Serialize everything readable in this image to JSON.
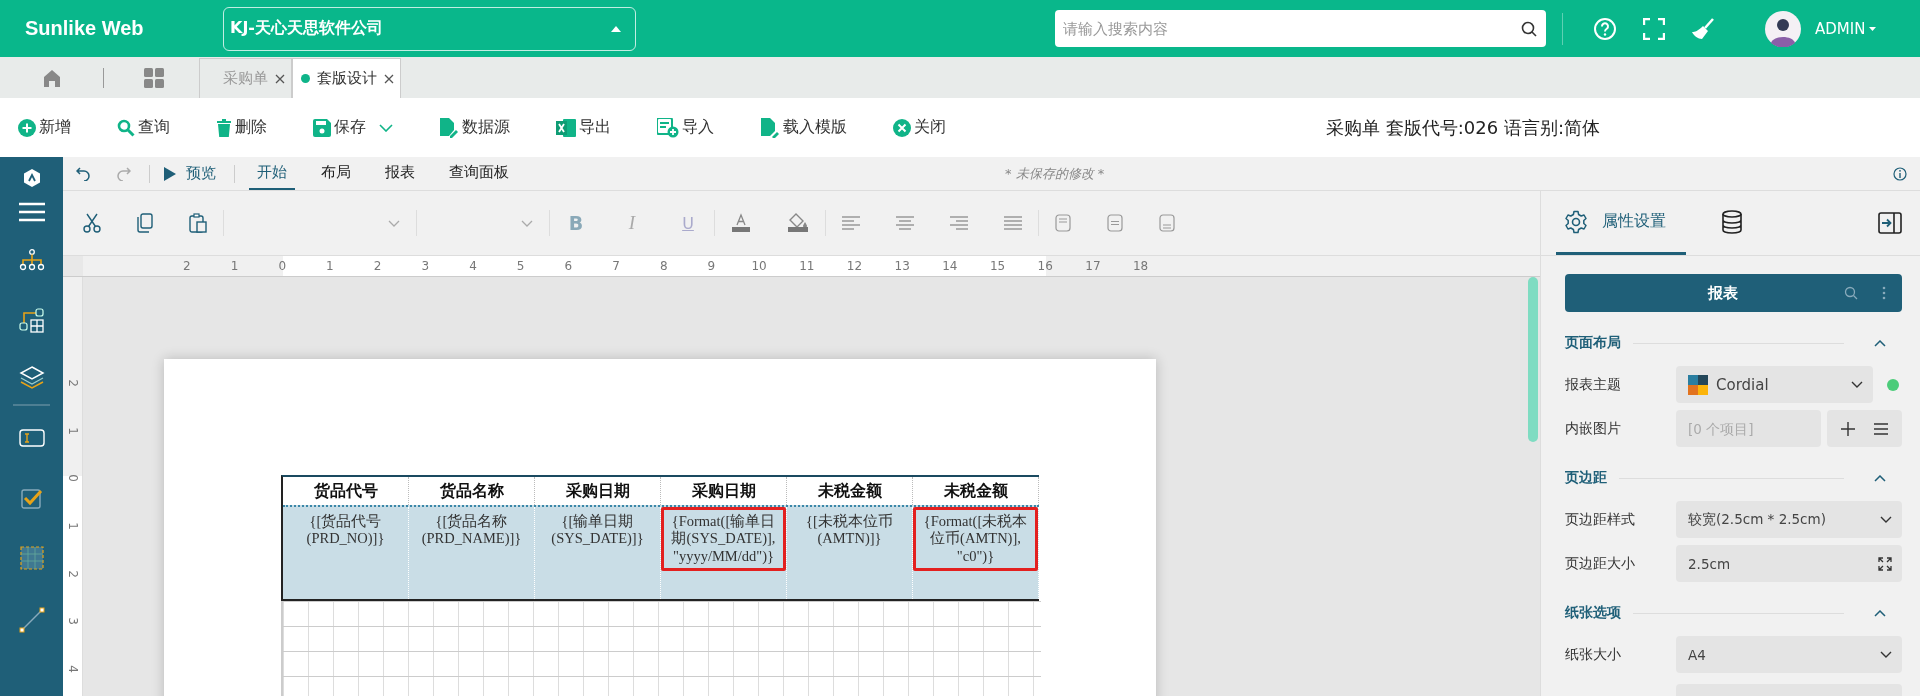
{
  "header": {
    "logo": "Sunlike Web",
    "company": "KJ-天心天思软件公司",
    "search": {
      "placeholder": "请输入搜索内容"
    },
    "user": "ADMIN"
  },
  "tabs": [
    {
      "label": "采购单",
      "selected": false
    },
    {
      "label": "套版设计",
      "selected": true
    }
  ],
  "toolbar": {
    "buttons": [
      {
        "label": "新增",
        "dropdown": false
      },
      {
        "label": "查询",
        "dropdown": false
      },
      {
        "label": "删除",
        "dropdown": false
      },
      {
        "label": "保存",
        "dropdown": true
      },
      {
        "label": "数据源",
        "dropdown": false
      },
      {
        "label": "导出",
        "dropdown": false
      },
      {
        "label": "导入",
        "dropdown": false
      },
      {
        "label": "载入模版",
        "dropdown": false
      },
      {
        "label": "关闭",
        "dropdown": false
      }
    ],
    "document_title": "采购单 套版代号:026 语言别:简体"
  },
  "designer": {
    "preview": "预览",
    "tabs": [
      {
        "label": "开始",
        "selected": true
      },
      {
        "label": "布局",
        "selected": false
      },
      {
        "label": "报表",
        "selected": false
      },
      {
        "label": "查询面板",
        "selected": false
      }
    ],
    "status": "* 未保存的修改 *",
    "ribbon": {
      "format_buttons": [
        "B",
        "I",
        "U"
      ]
    },
    "ruler": {
      "horizontal": [
        "2",
        "1",
        "0",
        "1",
        "2",
        "3",
        "4",
        "5",
        "6",
        "7",
        "8",
        "9",
        "10",
        "11",
        "12",
        "13",
        "14",
        "15",
        "16",
        "17",
        "18"
      ],
      "vertical": [
        "2",
        "1",
        "0",
        "1",
        "2",
        "3",
        "4"
      ]
    },
    "report_table": {
      "columns": [
        "货品代号",
        "货品名称",
        "采购日期",
        "采购日期",
        "未税金额",
        "未税金额"
      ],
      "cells": [
        {
          "text": "{[货品代号(PRD_NO)]}",
          "highlighted": false
        },
        {
          "text": "{[货品名称(PRD_NAME)]}",
          "highlighted": false
        },
        {
          "text": "{[输单日期(SYS_DATE)]}",
          "highlighted": false
        },
        {
          "text": "{Format([输单日期(SYS_DATE)], \"yyyy/MM/dd\")}",
          "highlighted": true
        },
        {
          "text": "{[未税本位币(AMTN)]}",
          "highlighted": false
        },
        {
          "text": "{Format([未税本位币(AMTN)], \"c0\")}",
          "highlighted": true
        }
      ]
    }
  },
  "properties": {
    "panel_tabs": [
      {
        "kind": "settings",
        "label": "属性设置",
        "selected": true
      },
      {
        "kind": "database",
        "selected": false
      }
    ],
    "object": "报表",
    "sections": [
      {
        "title": "页面布局",
        "expanded": true,
        "fields": [
          {
            "label": "报表主题",
            "kind": "theme",
            "value": "Cordial"
          },
          {
            "label": "内嵌图片",
            "kind": "collection",
            "placeholder": "[0 个项目]"
          }
        ]
      },
      {
        "title": "页边距",
        "expanded": true,
        "fields": [
          {
            "label": "页边距样式",
            "kind": "select",
            "value": "较宽(2.5cm * 2.5cm)"
          },
          {
            "label": "页边距大小",
            "kind": "size",
            "value": "2.5cm"
          }
        ]
      },
      {
        "title": "纸张选项",
        "expanded": true,
        "fields": [
          {
            "label": "纸张大小",
            "kind": "select",
            "value": "A4"
          }
        ]
      }
    ]
  }
}
